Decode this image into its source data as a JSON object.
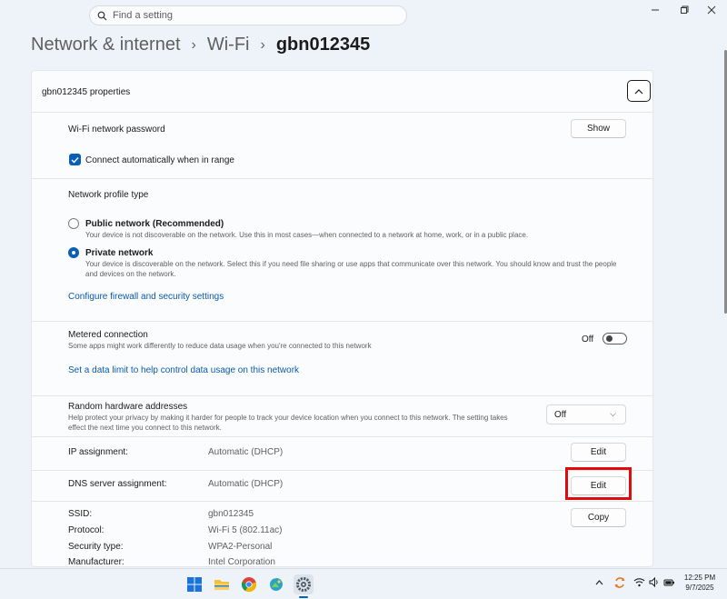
{
  "search": {
    "placeholder": "Find a setting",
    "icon": "search-icon"
  },
  "breadcrumb": {
    "level1": "Network & internet",
    "level2": "Wi-Fi",
    "current": "gbn012345",
    "separator": "›"
  },
  "card": {
    "title": "gbn012345 properties",
    "password": {
      "label": "Wi-Fi network password",
      "button": "Show"
    },
    "auto_connect": {
      "label": "Connect automatically when in range",
      "checked": true
    },
    "profile": {
      "heading": "Network profile type",
      "public": {
        "label": "Public network (Recommended)",
        "desc": "Your device is not discoverable on the network. Use this in most cases—when connected to a network at home, work, or in a public place.",
        "selected": false
      },
      "private": {
        "label": "Private network",
        "desc": "Your device is discoverable on the network. Select this if you need file sharing or use apps that communicate over this network. You should know and trust the people and devices on the network.",
        "selected": true
      },
      "firewall_link": "Configure firewall and security settings"
    },
    "metered": {
      "label": "Metered connection",
      "desc": "Some apps might work differently to reduce data usage when you're connected to this network",
      "state": "Off",
      "link": "Set a data limit to help control data usage on this network"
    },
    "random_hw": {
      "label": "Random hardware addresses",
      "desc": "Help protect your privacy by making it harder for people to track your device location when you connect to this network. The setting takes effect the next time you connect to this network.",
      "value": "Off"
    },
    "ip": {
      "label": "IP assignment:",
      "value": "Automatic (DHCP)",
      "button": "Edit"
    },
    "dns": {
      "label": "DNS server assignment:",
      "value": "Automatic (DHCP)",
      "button": "Edit"
    },
    "details": {
      "copy_button": "Copy",
      "rows": [
        {
          "label": "SSID:",
          "value": "gbn012345"
        },
        {
          "label": "Protocol:",
          "value": "Wi-Fi 5 (802.11ac)"
        },
        {
          "label": "Security type:",
          "value": "WPA2-Personal"
        },
        {
          "label": "Manufacturer:",
          "value": "Intel Corporation"
        }
      ]
    }
  },
  "taskbar": {
    "apps": [
      "windows-start-icon",
      "file-explorer-icon",
      "chrome-icon",
      "photos-icon",
      "settings-icon"
    ],
    "time": "12:25 PM",
    "date": "9/7/2025"
  },
  "colors": {
    "accent": "#0a5fb4",
    "link": "#0a5aa8",
    "highlight": "#e10b0b",
    "background": "#eef3f9"
  }
}
